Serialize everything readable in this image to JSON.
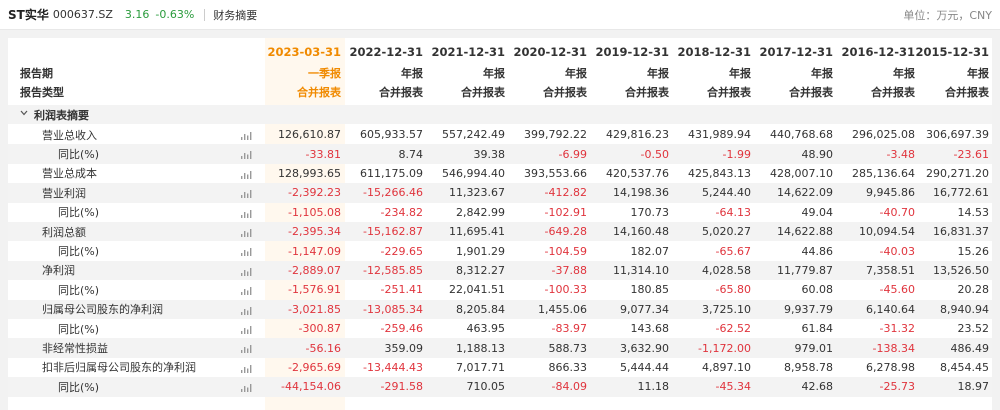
{
  "header": {
    "stock_name": "ST实华",
    "stock_code": "000637.SZ",
    "price": "3.16",
    "change_pct": "-0.63%",
    "page_title": "财务摘要",
    "unit": "单位：万元，CNY"
  },
  "columns": [
    {
      "date": "2023-03-31",
      "period": "一季报",
      "type": "合并报表",
      "highlight": true
    },
    {
      "date": "2022-12-31",
      "period": "年报",
      "type": "合并报表",
      "highlight": false
    },
    {
      "date": "2021-12-31",
      "period": "年报",
      "type": "合并报表",
      "highlight": false
    },
    {
      "date": "2020-12-31",
      "period": "年报",
      "type": "合并报表",
      "highlight": false
    },
    {
      "date": "2019-12-31",
      "period": "年报",
      "type": "合并报表",
      "highlight": false
    },
    {
      "date": "2018-12-31",
      "period": "年报",
      "type": "合并报表",
      "highlight": false
    },
    {
      "date": "2017-12-31",
      "period": "年报",
      "type": "合并报表",
      "highlight": false
    },
    {
      "date": "2016-12-31",
      "period": "年报",
      "type": "合并报表",
      "highlight": false
    },
    {
      "date": "2015-12-31",
      "period": "年报",
      "type": "合并报表",
      "highlight": false
    }
  ],
  "row_labels": {
    "period": "报告期",
    "type": "报告类型",
    "section": "利润表摘要"
  },
  "rows": [
    {
      "label": "营业总收入",
      "level": 1,
      "values": [
        "126,610.87",
        "605,933.57",
        "557,242.49",
        "399,792.22",
        "429,816.23",
        "431,989.94",
        "440,768.68",
        "296,025.08",
        "306,697.39"
      ]
    },
    {
      "label": "同比(%)",
      "level": 2,
      "values": [
        "-33.81",
        "8.74",
        "39.38",
        "-6.99",
        "-0.50",
        "-1.99",
        "48.90",
        "-3.48",
        "-23.61"
      ]
    },
    {
      "label": "营业总成本",
      "level": 1,
      "values": [
        "128,993.65",
        "611,175.09",
        "546,994.40",
        "393,553.66",
        "420,537.76",
        "425,843.13",
        "428,007.10",
        "285,136.64",
        "290,271.20"
      ]
    },
    {
      "label": "营业利润",
      "level": 1,
      "values": [
        "-2,392.23",
        "-15,266.46",
        "11,323.67",
        "-412.82",
        "14,198.36",
        "5,244.40",
        "14,622.09",
        "9,945.86",
        "16,772.61"
      ]
    },
    {
      "label": "同比(%)",
      "level": 2,
      "values": [
        "-1,105.08",
        "-234.82",
        "2,842.99",
        "-102.91",
        "170.73",
        "-64.13",
        "49.04",
        "-40.70",
        "14.53"
      ]
    },
    {
      "label": "利润总额",
      "level": 1,
      "values": [
        "-2,395.34",
        "-15,162.87",
        "11,695.41",
        "-649.28",
        "14,160.48",
        "5,020.27",
        "14,622.88",
        "10,094.54",
        "16,831.37"
      ]
    },
    {
      "label": "同比(%)",
      "level": 2,
      "values": [
        "-1,147.09",
        "-229.65",
        "1,901.29",
        "-104.59",
        "182.07",
        "-65.67",
        "44.86",
        "-40.03",
        "15.26"
      ]
    },
    {
      "label": "净利润",
      "level": 1,
      "values": [
        "-2,889.07",
        "-12,585.85",
        "8,312.27",
        "-37.88",
        "11,314.10",
        "4,028.58",
        "11,779.87",
        "7,358.51",
        "13,526.50"
      ]
    },
    {
      "label": "同比(%)",
      "level": 2,
      "values": [
        "-1,576.91",
        "-251.41",
        "22,041.51",
        "-100.33",
        "180.85",
        "-65.80",
        "60.08",
        "-45.60",
        "20.28"
      ]
    },
    {
      "label": "归属母公司股东的净利润",
      "level": 1,
      "values": [
        "-3,021.85",
        "-13,085.34",
        "8,205.84",
        "1,455.06",
        "9,077.34",
        "3,725.10",
        "9,937.79",
        "6,140.64",
        "8,940.94"
      ]
    },
    {
      "label": "同比(%)",
      "level": 2,
      "values": [
        "-300.87",
        "-259.46",
        "463.95",
        "-83.97",
        "143.68",
        "-62.52",
        "61.84",
        "-31.32",
        "23.52"
      ]
    },
    {
      "label": "非经常性损益",
      "level": 1,
      "values": [
        "-56.16",
        "359.09",
        "1,188.13",
        "588.73",
        "3,632.90",
        "-1,172.00",
        "979.01",
        "-138.34",
        "486.49"
      ]
    },
    {
      "label": "扣非后归属母公司股东的净利润",
      "level": 1,
      "values": [
        "-2,965.69",
        "-13,444.43",
        "7,017.71",
        "866.33",
        "5,444.44",
        "4,897.10",
        "8,958.78",
        "6,278.98",
        "8,454.45"
      ]
    },
    {
      "label": "同比(%)",
      "level": 2,
      "values": [
        "-44,154.06",
        "-291.58",
        "710.05",
        "-84.09",
        "11.18",
        "-45.34",
        "42.68",
        "-25.73",
        "18.97"
      ]
    }
  ],
  "colors": {
    "negative": "#e0343d",
    "highlight": "#f08a00",
    "price_down": "#2a9b3c"
  },
  "icons": {
    "chart": "bar-chart-icon",
    "section_toggle": "chevron-down-icon"
  }
}
